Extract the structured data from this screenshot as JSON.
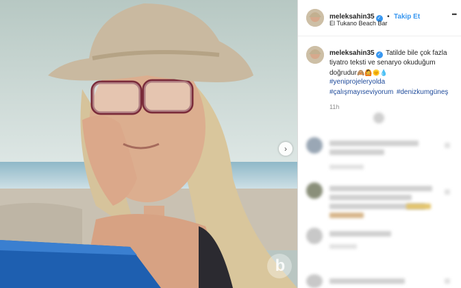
{
  "post": {
    "username": "meleksahin35",
    "follow_label": "Takip Et",
    "location": "El Tukano Beach Bar",
    "more_label": "•••"
  },
  "caption": {
    "username": "meleksahin35",
    "text_line1": "Tatilde bile çok fazla",
    "text_line2": "tiyatro teksti ve senaryo okuduğum",
    "text_line3": "doğrudur",
    "emojis": "🙈🙆🌞💧",
    "hashtag1": "#yeniprojeleryolda",
    "hashtag2": "#çalışmayıseviyorum",
    "hashtag3": "#denizkumgüneş",
    "time": "11h"
  },
  "icons": {
    "verified": "checkmark-badge-icon",
    "next": "chevron-right-icon",
    "watermark": "b-logo-icon"
  },
  "colors": {
    "accent": "#3897f0",
    "hashtag": "#1f4b9b"
  }
}
